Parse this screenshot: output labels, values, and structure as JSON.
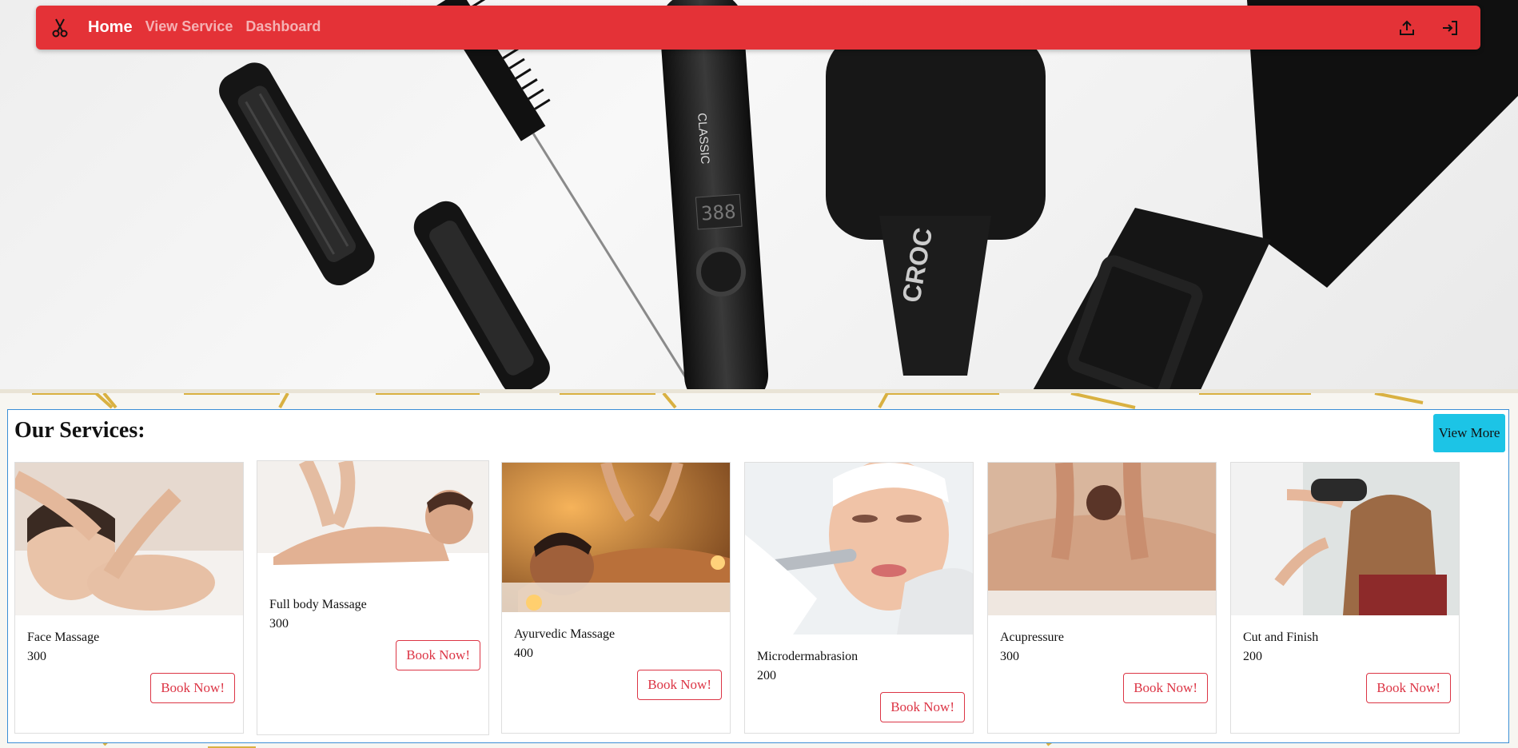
{
  "navbar": {
    "brand_icon": "scissors-icon",
    "links": [
      {
        "label": "Home",
        "active": true
      },
      {
        "label": "View Service",
        "active": false
      },
      {
        "label": "Dashboard",
        "active": false
      }
    ],
    "right_icons": [
      "upload-icon",
      "sign-in-icon"
    ],
    "color": "#e43237"
  },
  "hero": {
    "image": "hair styling tools (clips, comb, straightener, brush, dryer) on white surface",
    "brand_mark": "CROC",
    "straightener_text": "CLASSIC",
    "display_text": "388"
  },
  "services": {
    "title": "Our Services:",
    "view_more_label": "View More",
    "view_more_color": "#1cc4e6",
    "book_label": "Book Now!",
    "book_color": "#dc3545",
    "items": [
      {
        "name": "Face Massage",
        "price": "300",
        "image": "woman receiving face massage"
      },
      {
        "name": "Full body Massage",
        "price": "300",
        "image": "man receiving back massage"
      },
      {
        "name": "Ayurvedic Massage",
        "price": "400",
        "image": "man receiving oil massage with candles"
      },
      {
        "name": "Microdermabrasion",
        "price": "200",
        "image": "woman receiving microdermabrasion treatment"
      },
      {
        "name": "Acupressure",
        "price": "300",
        "image": "hands pressing on back shoulders"
      },
      {
        "name": "Cut and Finish",
        "price": "200",
        "image": "stylist blow-drying client hair"
      }
    ]
  }
}
